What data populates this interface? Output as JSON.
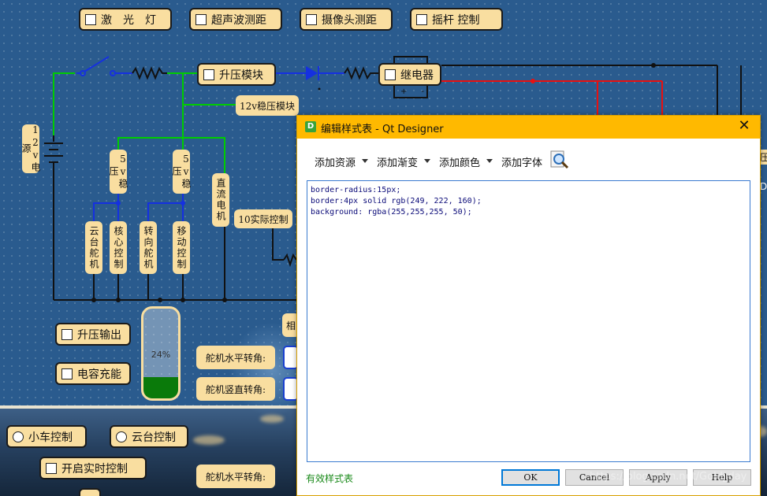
{
  "top_buttons": [
    "激　光　灯",
    "超声波测距",
    "摄像头测距",
    "摇杆 控制"
  ],
  "circuit": {
    "boost_module": "升压模块",
    "relay": "继电器",
    "relay_pins": [
      "+",
      "-"
    ],
    "regulator_12v": "12v稳压模块",
    "power_12v": "12v电源",
    "reg_5v_a": "5v稳压",
    "reg_5v_b": "5v稳压",
    "dc_motor": "直流电机",
    "gimbal_servo": "云台舵机",
    "core_control": "核心控制",
    "steering_servo": "转向舵机",
    "motion_control": "移动控制",
    "realtime_control": "10实际控制"
  },
  "left_buttons": {
    "boost_output": "升压输出",
    "capacitor_charge": "电容充能"
  },
  "gauge": {
    "value_percent": 24,
    "label": "24%"
  },
  "servo_labels": {
    "horizontal": "舵机水平转角:",
    "vertical": "舵机竖直转角:",
    "horizontal_2": "舵机水平转角:"
  },
  "partial_label": "相",
  "bottom_controls": {
    "car_control": "小车控制",
    "gimbal_control": "云台控制",
    "realtime_control": "开启实时控制"
  },
  "right_edge_glyphs": [
    "压",
    "D"
  ],
  "dialog": {
    "title": "编辑样式表 - Qt Designer",
    "title_icon": "D",
    "close": "✕",
    "toolbar": [
      "添加资源",
      "添加渐变",
      "添加颜色",
      "添加字体"
    ],
    "stylesheet_lines": [
      "border-radius:15px;",
      "border:4px solid rgb(249, 222, 160);",
      "background: rgba(255,255,255, 50);"
    ],
    "status": "有效样式表",
    "buttons": {
      "ok": "OK",
      "cancel": "Cancel",
      "apply": "Apply",
      "help": "Help"
    }
  },
  "watermark": "https://blog.csdn.net/Gold_day",
  "colors": {
    "panel": "#f9dea0",
    "wire_green": "#00cc00",
    "wire_blue": "#1530e0",
    "wire_red": "#e81010",
    "titlebar": "#ffb900",
    "gauge_fill": "#0a7a0a"
  }
}
